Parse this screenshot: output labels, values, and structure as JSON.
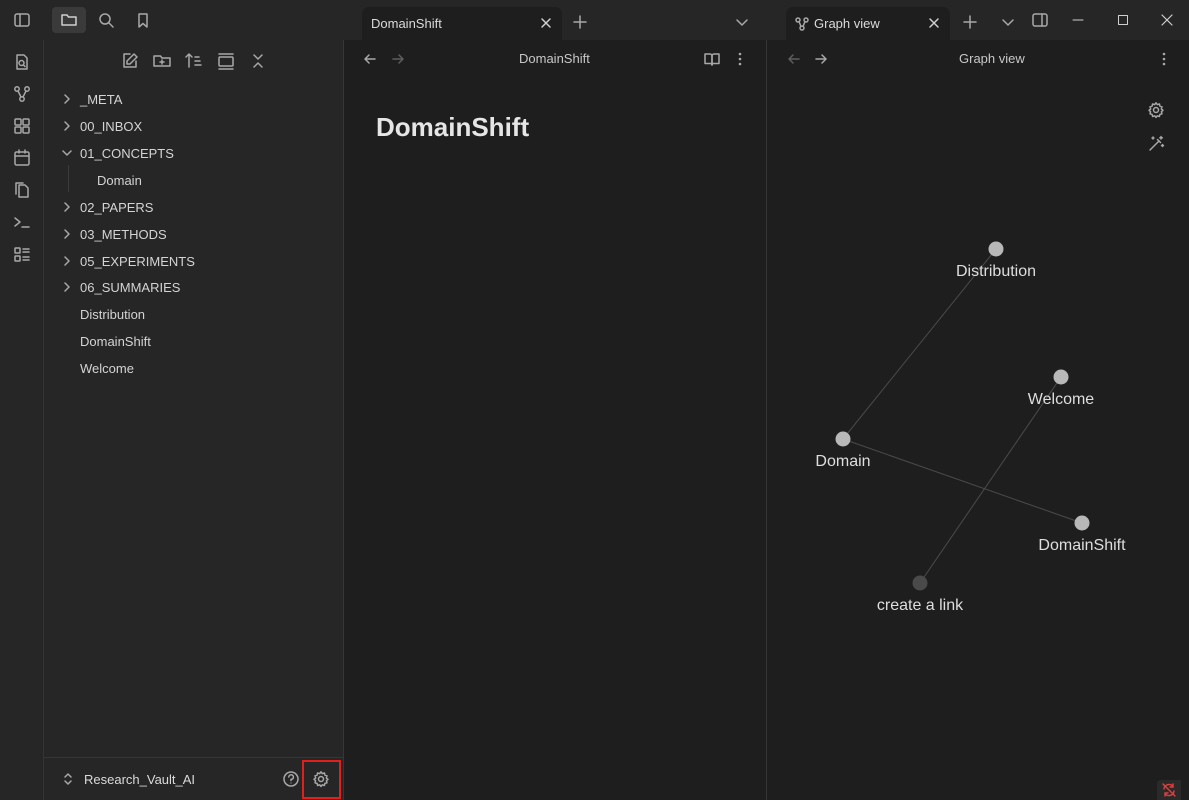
{
  "tabs": [
    {
      "label": "DomainShift",
      "active": false
    },
    {
      "label": "Graph view",
      "active": true
    }
  ],
  "sidebar": {
    "tree": [
      {
        "label": "_META",
        "type": "folder",
        "expanded": false,
        "depth": 0
      },
      {
        "label": "00_INBOX",
        "type": "folder",
        "expanded": false,
        "depth": 0
      },
      {
        "label": "01_CONCEPTS",
        "type": "folder",
        "expanded": true,
        "depth": 0
      },
      {
        "label": "Domain",
        "type": "file",
        "depth": 1
      },
      {
        "label": "02_PAPERS",
        "type": "folder",
        "expanded": false,
        "depth": 0
      },
      {
        "label": "03_METHODS",
        "type": "folder",
        "expanded": false,
        "depth": 0
      },
      {
        "label": "05_EXPERIMENTS",
        "type": "folder",
        "expanded": false,
        "depth": 0
      },
      {
        "label": "06_SUMMARIES",
        "type": "folder",
        "expanded": false,
        "depth": 0
      },
      {
        "label": "Distribution",
        "type": "file",
        "depth": 0
      },
      {
        "label": "DomainShift",
        "type": "file",
        "depth": 0
      },
      {
        "label": "Welcome",
        "type": "file",
        "depth": 0
      }
    ],
    "vault_name": "Research_Vault_AI"
  },
  "editor": {
    "header_title": "DomainShift",
    "doc_title": "DomainShift"
  },
  "graph": {
    "header_title": "Graph view",
    "nodes": [
      {
        "id": "distribution",
        "label": "Distribution",
        "color": "#b8b8b8"
      },
      {
        "id": "welcome",
        "label": "Welcome",
        "color": "#b8b8b8"
      },
      {
        "id": "domain",
        "label": "Domain",
        "color": "#b8b8b8"
      },
      {
        "id": "domainshift",
        "label": "DomainShift",
        "color": "#b8b8b8"
      },
      {
        "id": "create-link",
        "label": "create a link",
        "color": "#4a4a4a"
      }
    ],
    "edges": [
      [
        "domain",
        "distribution"
      ],
      [
        "domain",
        "domainshift"
      ],
      [
        "welcome",
        "create-link"
      ]
    ]
  },
  "colors": {
    "accent_highlight": "#e0201f",
    "sync_error": "#e0403f"
  }
}
